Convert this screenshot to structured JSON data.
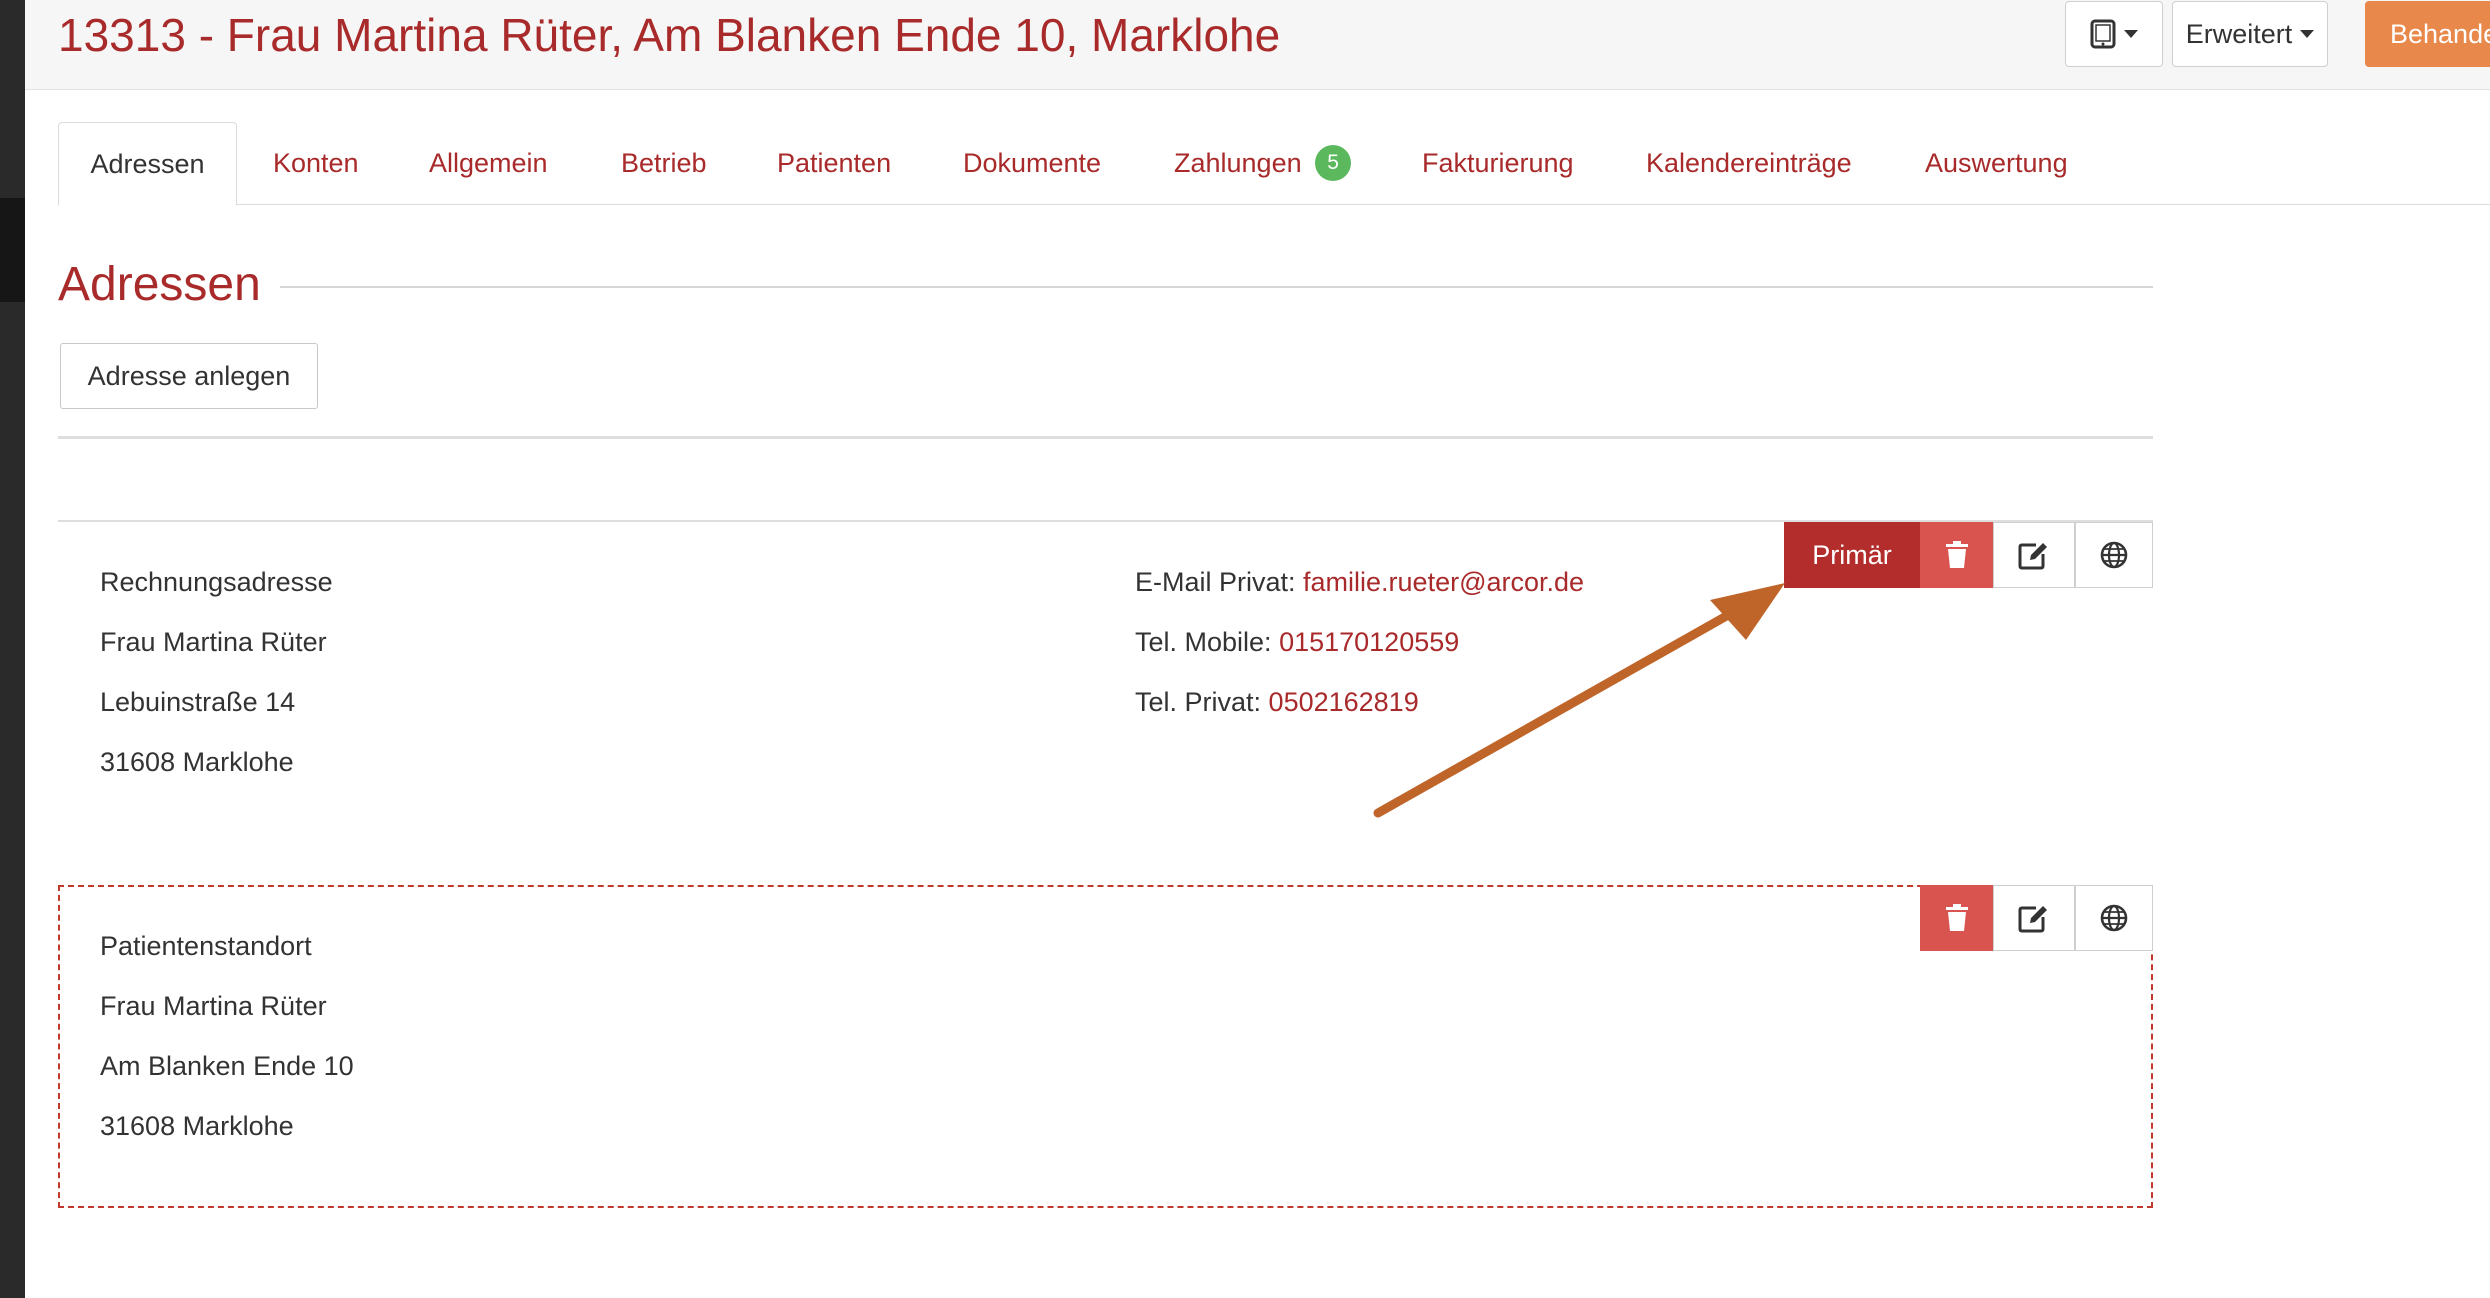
{
  "header": {
    "title": "13313 - Frau Martina Rüter, Am Blanken Ende 10, Marklohe",
    "device_menu_icon": "tablet-icon",
    "erweitert_label": "Erweitert",
    "behandeln_label": "Behandeln"
  },
  "tabs": [
    {
      "label": "Adressen",
      "active": true
    },
    {
      "label": "Konten"
    },
    {
      "label": "Allgemein"
    },
    {
      "label": "Betrieb"
    },
    {
      "label": "Patienten"
    },
    {
      "label": "Dokumente"
    },
    {
      "label": "Zahlungen",
      "badge": "5"
    },
    {
      "label": "Fakturierung"
    },
    {
      "label": "Kalendereinträge"
    },
    {
      "label": "Auswertung"
    }
  ],
  "section": {
    "title": "Adressen",
    "add_button": "Adresse anlegen"
  },
  "addresses": [
    {
      "type": "Rechnungsadresse",
      "name": "Frau Martina Rüter",
      "street": "Lebuinstraße 14",
      "city": "31608 Marklohe",
      "contacts": [
        {
          "label": "E-Mail Privat: ",
          "value": "familie.rueter@arcor.de"
        },
        {
          "label": "Tel. Mobile: ",
          "value": "015170120559"
        },
        {
          "label": "Tel. Privat: ",
          "value": "0502162819"
        }
      ],
      "primary_label": "Primär"
    },
    {
      "type": "Patientenstandort",
      "name": "Frau Martina Rüter",
      "street": "Am Blanken Ende 10",
      "city": "31608 Marklohe"
    }
  ],
  "icons": {
    "trash": "trash-icon",
    "edit": "edit-icon",
    "globe": "globe-icon"
  },
  "colors": {
    "brand_red": "#a92a2a",
    "primary_button": "#b32d2d",
    "danger": "#d9534f",
    "warning": "#e8884a",
    "badge_green": "#5cb85c",
    "annotation_arrow": "#c0652a"
  }
}
